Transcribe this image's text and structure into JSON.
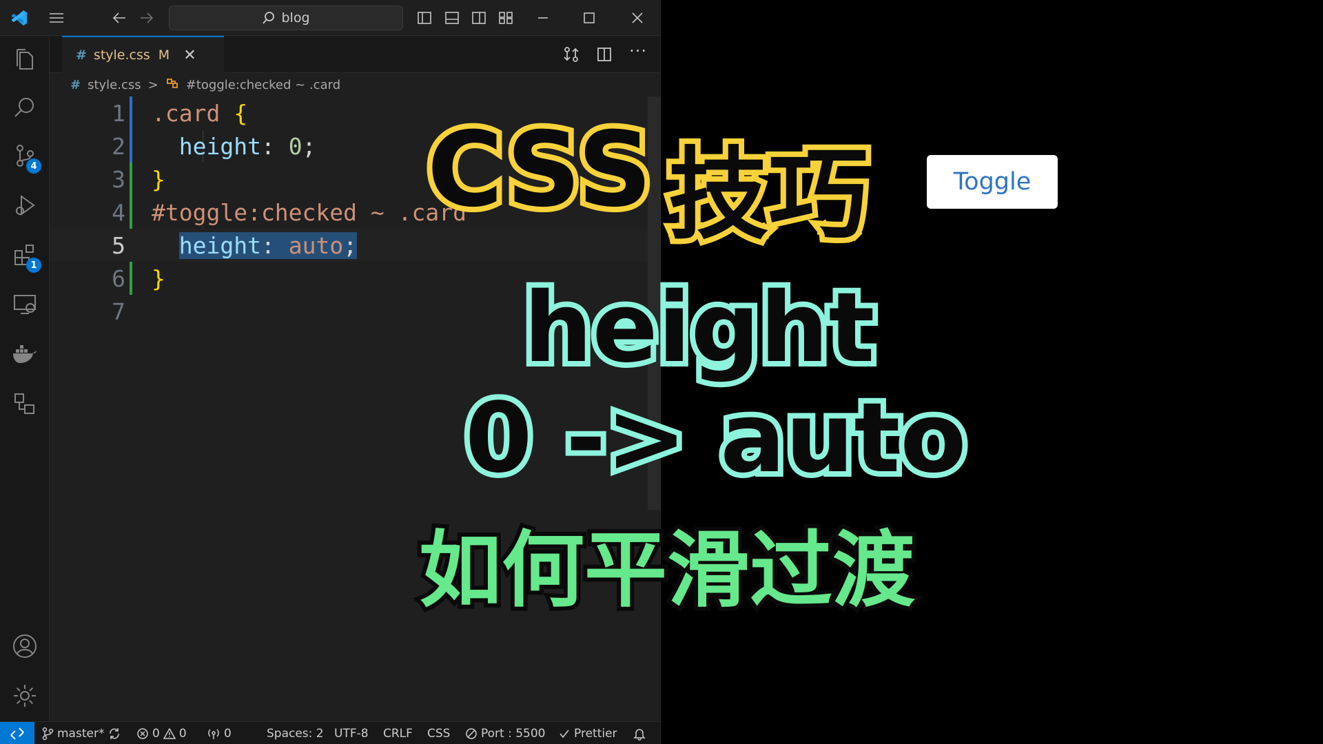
{
  "titlebar": {
    "search_text": "blog"
  },
  "activitybar": {
    "scm_badge": "4",
    "extensions_badge": "1"
  },
  "tab": {
    "hash": "#",
    "filename": "style.css",
    "modified": "M",
    "close": "✕"
  },
  "breadcrumb": {
    "hash": "#",
    "file": "style.css",
    "separator": ">",
    "selector": "#toggle:checked ~ .card"
  },
  "code": {
    "line_numbers": [
      "1",
      "2",
      "3",
      "4",
      "5",
      "6",
      "7"
    ],
    "line1": {
      "selector": ".card",
      "brace": "{"
    },
    "line2": {
      "prop": "height",
      "colon": ":",
      "value": "0",
      "semi": ";"
    },
    "line3": {
      "brace": "}"
    },
    "line4": {
      "selector": "#toggle:checked ~ .card"
    },
    "line5": {
      "prop": "height",
      "colon": ":",
      "value": "auto",
      "semi": ";"
    },
    "line6": {
      "brace": "}"
    }
  },
  "statusbar": {
    "branch": "master*",
    "errors": "0",
    "warnings": "0",
    "ports": "0",
    "spaces": "Spaces: 2",
    "encoding": "UTF-8",
    "eol": "CRLF",
    "language": "CSS",
    "port": "Port : 5500",
    "prettier": "Prettier"
  },
  "preview": {
    "toggle_label": "Toggle"
  },
  "overlay": {
    "line1_a": "CSS",
    "line1_b": "技巧",
    "line2": "height",
    "line3": "0 -> auto",
    "line4": "如何平滑过渡"
  },
  "colors": {
    "accent": "#0078d4",
    "overlay_yellow": "#f7d23a",
    "overlay_cyan": "#8ef3dd",
    "overlay_green": "#66e88c"
  }
}
